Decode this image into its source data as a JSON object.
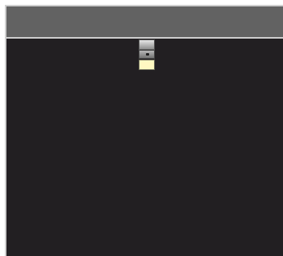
{
  "window": {
    "header_color": "#626262",
    "header_border_color": "#cdcdcd",
    "canvas_color": "#221f22",
    "frame_color": "#cfcfcf"
  },
  "sprite": {
    "icon": "stacked-block-sprite-icon",
    "top_color": "#c9c9c9",
    "middle_color": "#8d8d8d",
    "bottom_color": "#fff8c2"
  }
}
